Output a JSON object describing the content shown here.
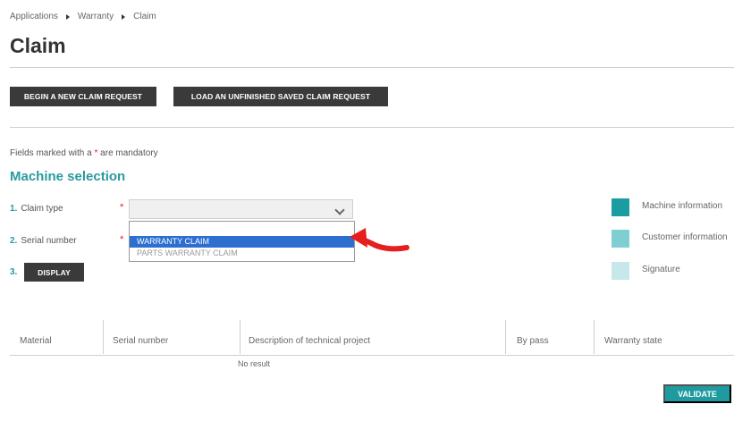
{
  "breadcrumb": [
    "Applications",
    "Warranty",
    "Claim"
  ],
  "page_title": "Claim",
  "actions": {
    "new_claim": "BEGIN A NEW CLAIM REQUEST",
    "load_claim": "LOAD AN UNFINISHED SAVED CLAIM REQUEST"
  },
  "mandatory_note": {
    "prefix": "Fields marked with a",
    "star": "*",
    "suffix": "are mandatory"
  },
  "section_title": "Machine selection",
  "steps": {
    "claim_type": {
      "num": "1.",
      "label": "Claim type",
      "required": "*"
    },
    "serial_number": {
      "num": "2.",
      "label": "Serial number",
      "required": "*"
    },
    "display": {
      "num": "3.",
      "button": "DISPLAY"
    }
  },
  "claim_type_dropdown": {
    "selected_value": "",
    "options": [
      "",
      "WARRANTY CLAIM",
      "PARTS WARRANTY CLAIM"
    ],
    "highlighted": "WARRANTY CLAIM"
  },
  "legend": [
    {
      "label": "Machine information",
      "color": "#1a9ca3"
    },
    {
      "label": "Customer information",
      "color": "#7fcfd2"
    },
    {
      "label": "Signature",
      "color": "#c6e8ea"
    }
  ],
  "table": {
    "columns": [
      "Material",
      "Serial number",
      "Description of technical project",
      "By pass",
      "Warranty state"
    ],
    "empty_text": "No result"
  },
  "validate_label": "VALIDATE",
  "colors": {
    "accent": "#1f9a9f",
    "annotation": "#e61e1e",
    "highlight": "#2c6fd1"
  }
}
